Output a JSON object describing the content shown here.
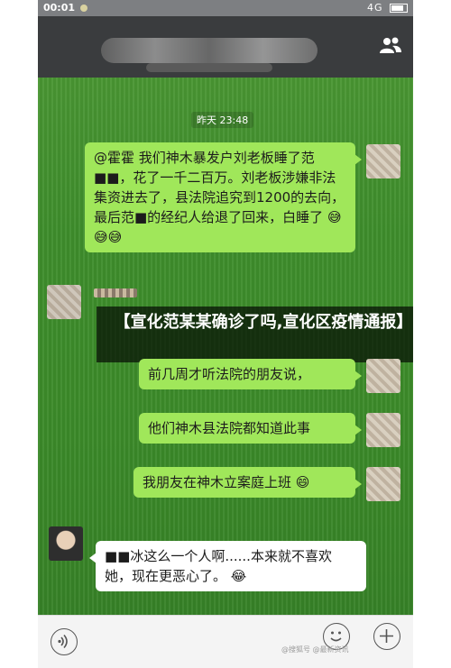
{
  "status_bar": {
    "time": "00:01",
    "network": "4G"
  },
  "chat": {
    "timestamp": "昨天 23:48",
    "messages": [
      {
        "side": "right",
        "text": "@霍霍 我们神木暴发户刘老板睡了范■■，花了一千二百万。刘老板涉嫌非法集资进去了，县法院追究到1200的去向，最后范■的经纪人给退了回来，白睡了"
      },
      {
        "side": "right",
        "text": "前几周才听法院的朋友说，"
      },
      {
        "side": "right",
        "text": "他们神木县法院都知道此事"
      },
      {
        "side": "right",
        "text": "我朋友在神木立案庭上班"
      },
      {
        "side": "left",
        "text": "■■冰这么一个人啊......本来就不喜欢她，现在更恶心了。"
      }
    ]
  },
  "banner": {
    "text": "【宣化范某某确诊了吗,宣化区疫情通报】"
  },
  "emojis": {
    "bubble1": "😅😅😅",
    "bubble4": "😄",
    "bubble5": "😂"
  },
  "watermark": {
    "text": "@搜狐号 @最新资讯"
  },
  "icons": [
    "group-members-icon",
    "voice-icon",
    "emoji-icon",
    "plus-icon",
    "battery-icon"
  ]
}
